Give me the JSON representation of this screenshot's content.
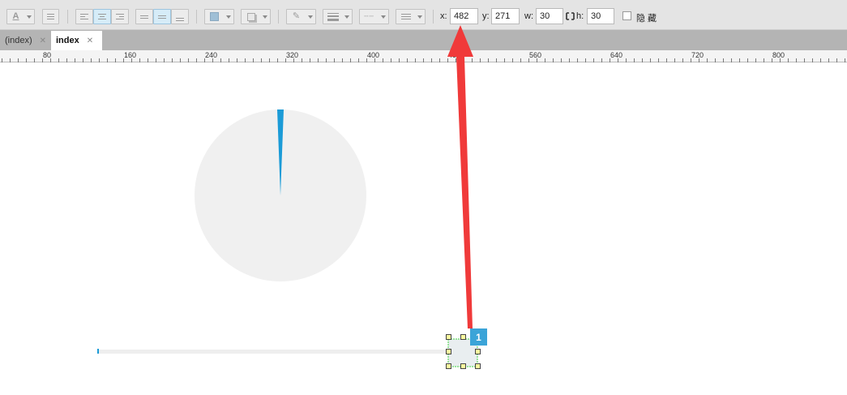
{
  "toolbar": {
    "font_color_icon": "font-color-icon",
    "x_label": "x:",
    "x_value": "482",
    "y_label": "y:",
    "y_value": "271",
    "w_label": "w:",
    "w_value": "30",
    "h_label": "h:",
    "h_value": "30",
    "hidden_label": "隐 藏",
    "lock_icon": "aspect-lock-icon"
  },
  "tabs": [
    {
      "label": "(index)",
      "close": "✕"
    },
    {
      "label": "index",
      "close": "✕"
    }
  ],
  "ruler": {
    "ticks": [
      "80",
      "160",
      "240",
      "320",
      "400",
      "48",
      "560",
      "640",
      "720",
      "800"
    ]
  },
  "canvas": {
    "pie": {
      "track_color": "#f0f0f0",
      "fill_color": "#1b9bd7",
      "value_fraction": 0.012
    },
    "slider": {
      "track_color": "#eeeeee",
      "fill_color": "#1b9bd7",
      "value": 0,
      "handle_color": "#e9eef0"
    },
    "badge_number": "1",
    "arrow_color": "#f03a3a"
  },
  "colors": {
    "accent": "#3ba4d8",
    "selection_border": "#3cd33c"
  }
}
